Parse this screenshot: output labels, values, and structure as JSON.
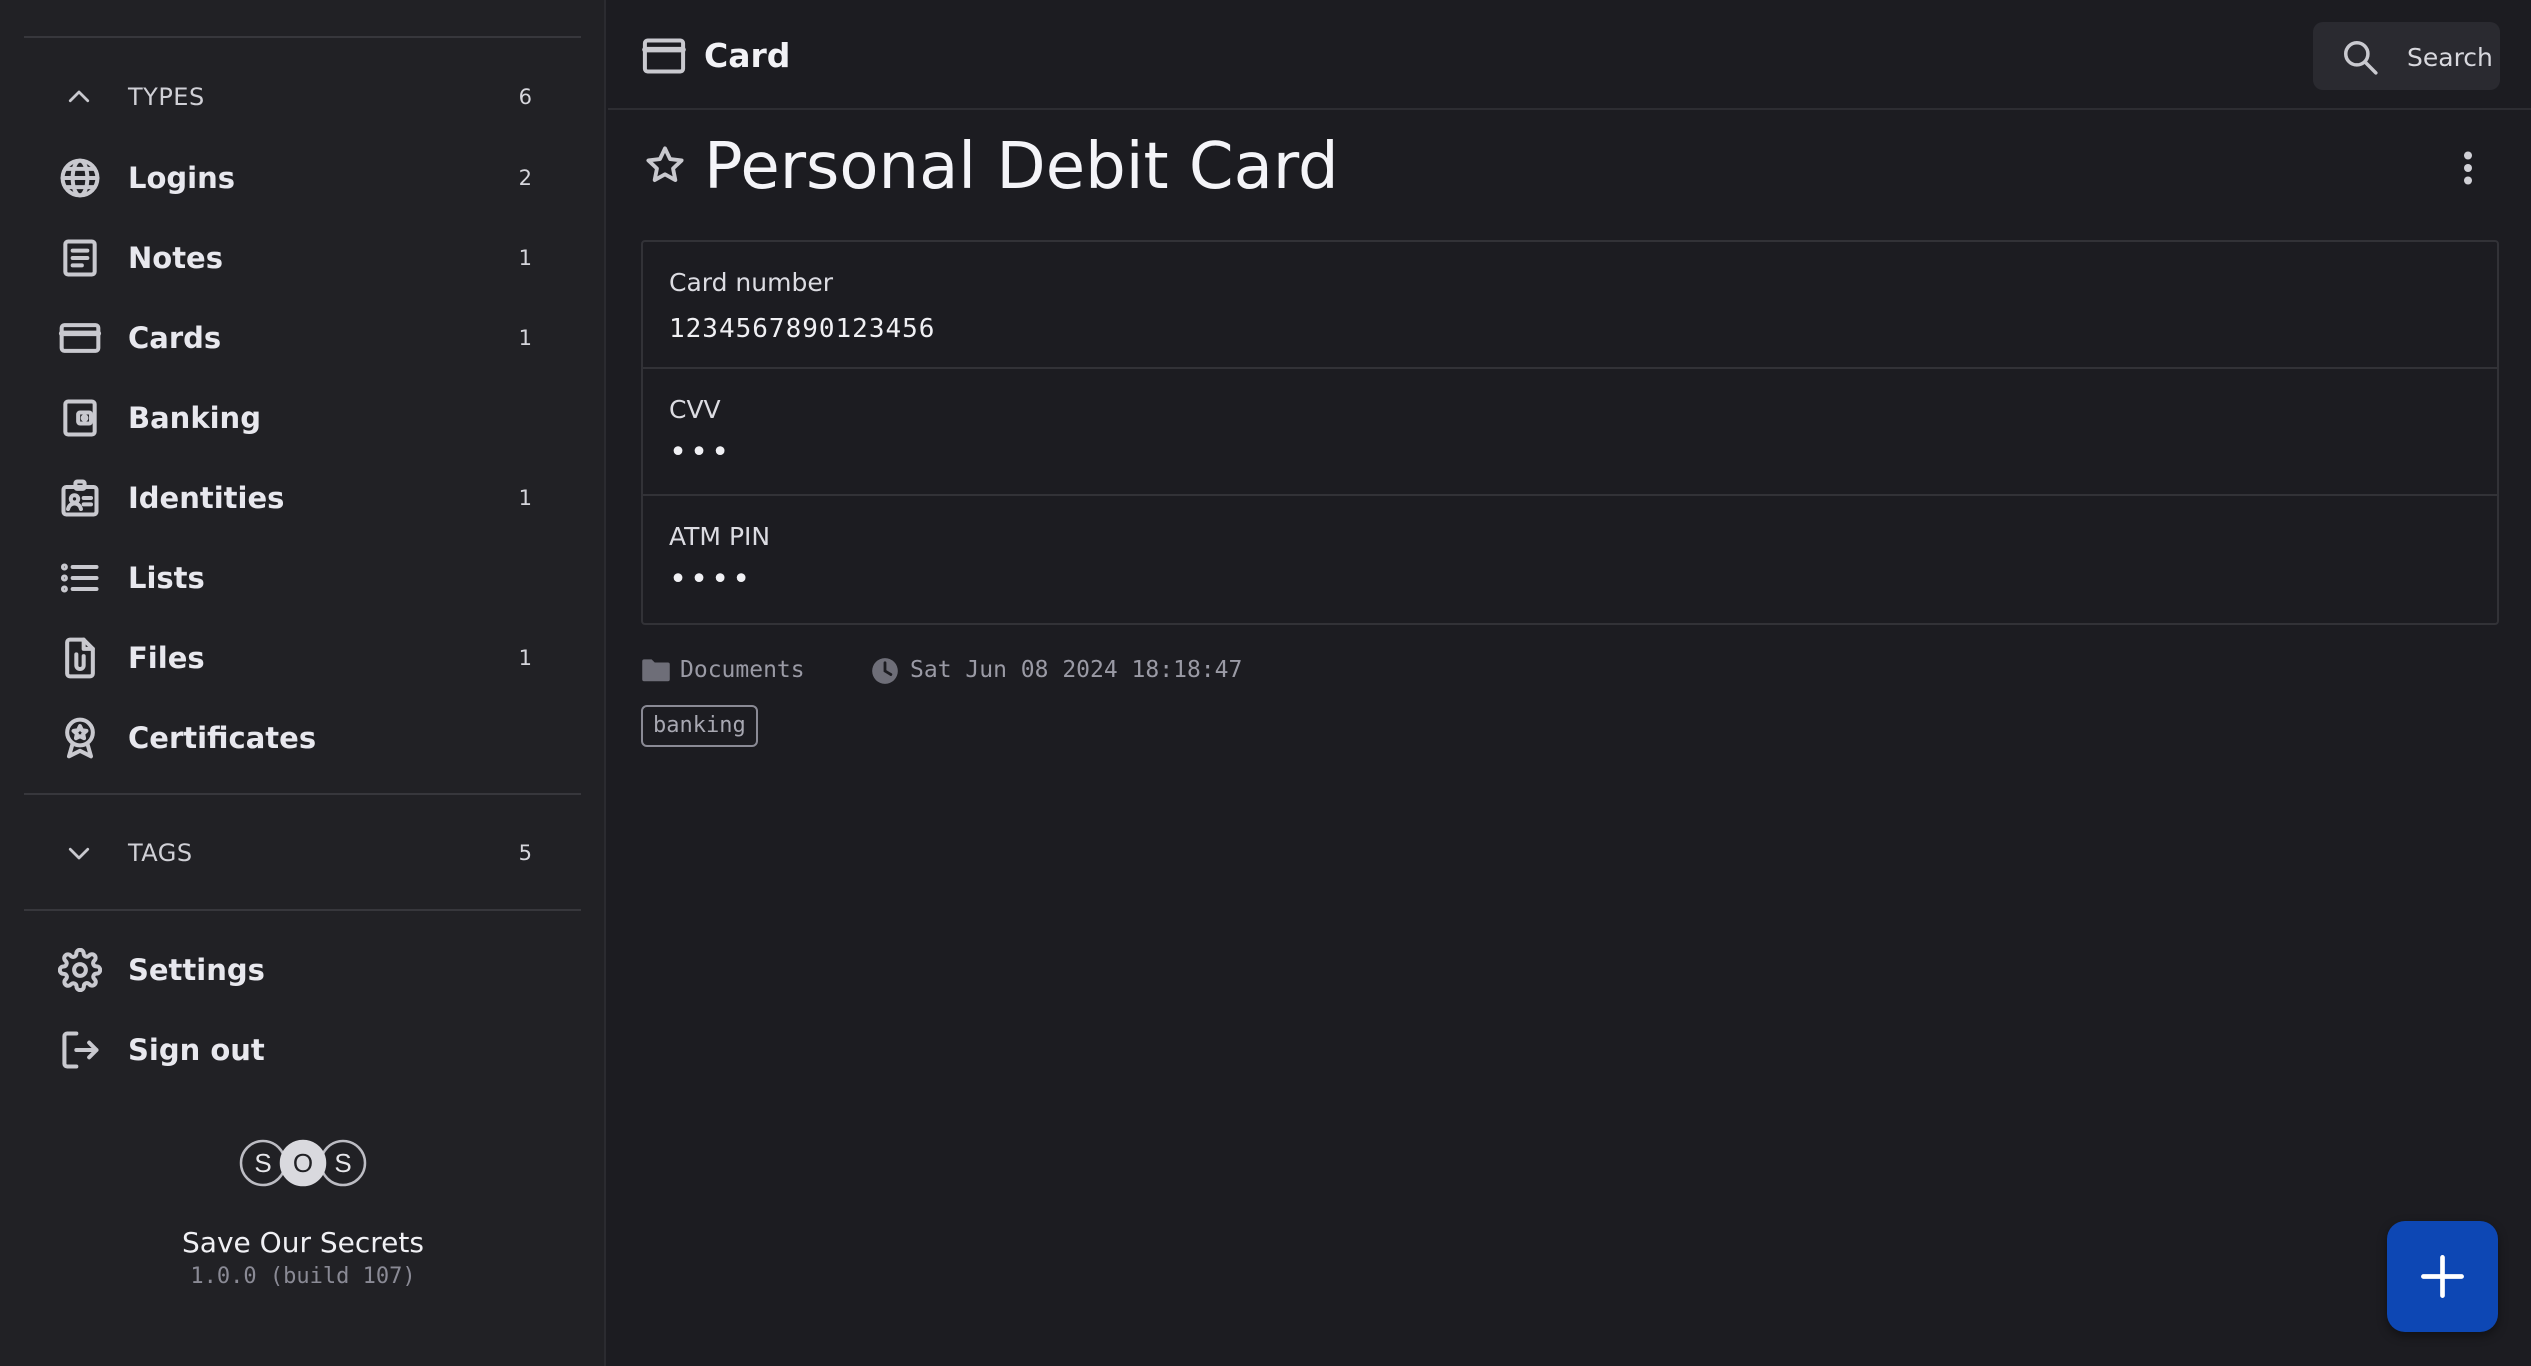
{
  "sidebar": {
    "types": {
      "label": "TYPES",
      "count": "6"
    },
    "items": [
      {
        "label": "Logins",
        "count": "2",
        "icon": "globe-icon"
      },
      {
        "label": "Notes",
        "count": "1",
        "icon": "note-icon"
      },
      {
        "label": "Cards",
        "count": "1",
        "icon": "card-icon"
      },
      {
        "label": "Banking",
        "count": "",
        "icon": "bank-icon"
      },
      {
        "label": "Identities",
        "count": "1",
        "icon": "id-badge-icon"
      },
      {
        "label": "Lists",
        "count": "",
        "icon": "list-icon"
      },
      {
        "label": "Files",
        "count": "1",
        "icon": "file-clip-icon"
      },
      {
        "label": "Certificates",
        "count": "",
        "icon": "award-icon"
      }
    ],
    "tags": {
      "label": "TAGS",
      "count": "5"
    },
    "settings_label": "Settings",
    "signout_label": "Sign out",
    "brand": {
      "logo_letters": [
        "S",
        "O",
        "S"
      ],
      "name": "Save Our Secrets",
      "version": "1.0.0 (build 107)"
    }
  },
  "header": {
    "title": "Card",
    "search_label": "Search"
  },
  "item": {
    "title": "Personal Debit Card",
    "fields": [
      {
        "label": "Card number",
        "value": "1234567890123456"
      },
      {
        "label": "CVV",
        "value": "•••"
      },
      {
        "label": "ATM PIN",
        "value": "••••"
      }
    ],
    "folder": "Documents",
    "modified": "Sat Jun 08 2024 18:18:47",
    "tags": [
      "banking"
    ]
  },
  "colors": {
    "background": "#1c1c21",
    "sidebar": "#212125",
    "accent": "#0d47b4"
  }
}
